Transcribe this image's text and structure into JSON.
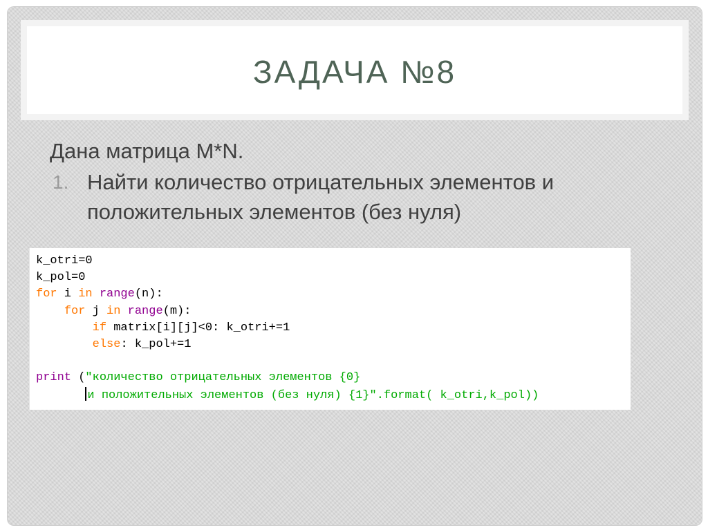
{
  "slide": {
    "title": "ЗАДАЧА №8",
    "intro": "Дана матрица M*N.",
    "list": [
      {
        "num": "1.",
        "text": "Найти количество отрицательных элементов и положительных элементов (без нуля)"
      }
    ]
  },
  "code": {
    "l1": "k_otri=0",
    "l2": "k_pol=0",
    "l3_kw_for": "for",
    "l3_var": " i ",
    "l3_kw_in": "in",
    "l3_sp": " ",
    "l3_fn": "range",
    "l3_rest": "(n):",
    "l4_indent": "    ",
    "l4_kw_for": "for",
    "l4_var": " j ",
    "l4_kw_in": "in",
    "l4_sp": " ",
    "l4_fn": "range",
    "l4_rest": "(m):",
    "l5_indent": "        ",
    "l5_kw_if": "if",
    "l5_rest": " matrix[i][j]<0: k_otri+=1",
    "l6_indent": "        ",
    "l6_kw_else": "else",
    "l6_rest": ": k_pol+=1",
    "l8_fn": "print",
    "l8_paren": " (",
    "l8_str": "\"количество отрицательных элементов {0}",
    "l9_indent": "       ",
    "l9_str": "и положительных элементов (без нуля) {1}\"",
    "l9_rest": ".format( k_otri,k_pol))"
  },
  "colors": {
    "keyword": "#ff7700",
    "builtin": "#900090",
    "string": "#00aa00",
    "title": "#4f6456"
  }
}
